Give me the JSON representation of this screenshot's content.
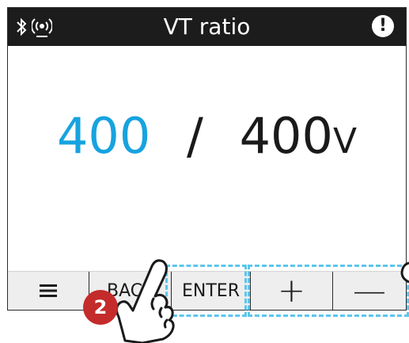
{
  "titlebar": {
    "title": "VT ratio",
    "icons": [
      "bluetooth-icon",
      "wireless-signal-icon",
      "alert-icon"
    ],
    "alert_glyph": "!"
  },
  "main": {
    "primary_value": "400",
    "separator": "/",
    "secondary_value": "400",
    "unit": "V",
    "primary_color": "#17a3df"
  },
  "softkeys": {
    "menu_icon": "menu-icon",
    "back_label": "BACK",
    "enter_label": "ENTER",
    "plus_glyph": "+",
    "minus_glyph": "—"
  },
  "overlay": {
    "step_number": "2",
    "badge_color": "#c42b2b",
    "highlight_color": "#5cc6ec",
    "pointer_icon": "tap-hand-icon"
  }
}
